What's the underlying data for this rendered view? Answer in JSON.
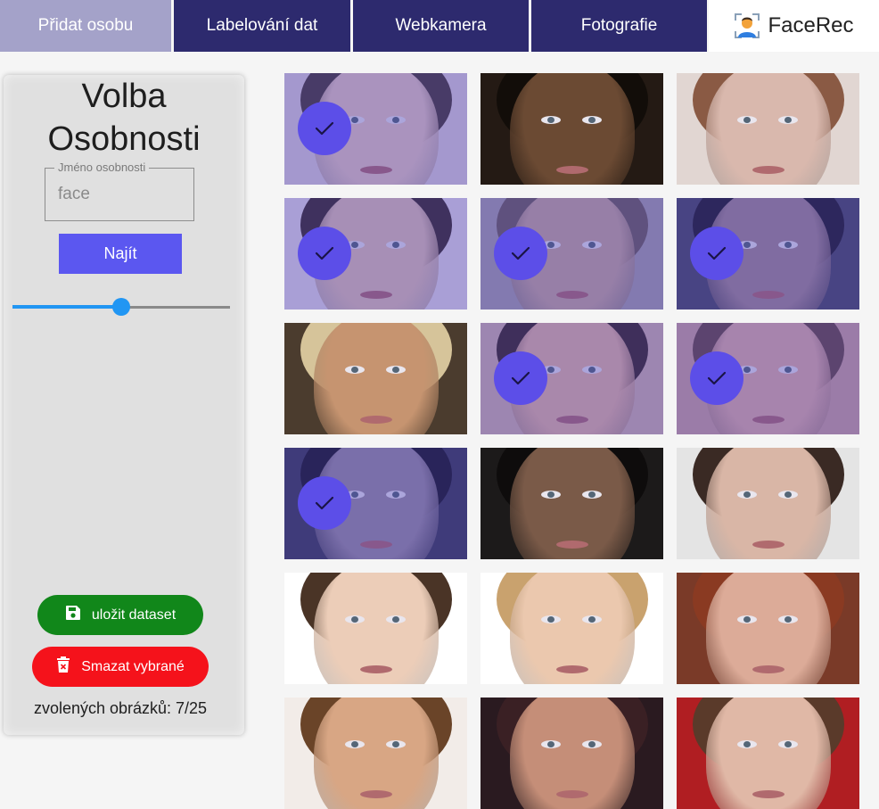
{
  "nav": {
    "tabs": [
      {
        "label": "Přidat osobu",
        "active": true
      },
      {
        "label": "Labelování dat"
      },
      {
        "label": "Webkamera"
      },
      {
        "label": "Fotografie"
      }
    ],
    "app_name": "FaceRec",
    "logo_icon": "user-face-icon"
  },
  "sidebar": {
    "title_line1": "Volba",
    "title_line2": "Osobnosti",
    "search": {
      "legend": "Jméno osobnosti",
      "value": "face"
    },
    "find_label": "Najít",
    "slider_value": 0.5,
    "save_label": "uložit dataset",
    "save_icon": "floppy-disk-icon",
    "delete_label": "Smazat vybrané",
    "delete_icon": "trash-icon",
    "count_text": "zvolených obrázků: 7/25"
  },
  "gallery": {
    "selected_icon": "checkmark-icon",
    "images": [
      {
        "selected": true,
        "bg": "#ddd0d8",
        "skin": "#e7c9bf",
        "hair": "#4a3a32"
      },
      {
        "selected": false,
        "bg": "#241a14",
        "skin": "#6b4a33",
        "hair": "#120d09"
      },
      {
        "selected": false,
        "bg": "#e1d6d2",
        "skin": "#d9b8ad",
        "hair": "#8a5a44"
      },
      {
        "selected": true,
        "bg": "#e6dce6",
        "skin": "#e2c2b2",
        "hair": "#3a2a24"
      },
      {
        "selected": true,
        "bg": "#a8a0a8",
        "skin": "#c8a89a",
        "hair": "#6e5e58"
      },
      {
        "selected": true,
        "bg": "#4a4a60",
        "skin": "#a48a90",
        "hair": "#1e1a22"
      },
      {
        "selected": false,
        "bg": "#4b3c2e",
        "skin": "#c69470",
        "hair": "#d6c49a"
      },
      {
        "selected": true,
        "bg": "#d2b4aa",
        "skin": "#e6b6a0",
        "hair": "#3a2820"
      },
      {
        "selected": true,
        "bg": "#cfa49c",
        "skin": "#e2b0a4",
        "hair": "#6a4a40"
      },
      {
        "selected": true,
        "bg": "#3a3a52",
        "skin": "#9a8e9e",
        "hair": "#18161e"
      },
      {
        "selected": false,
        "bg": "#1c1a1a",
        "skin": "#7a5a48",
        "hair": "#0e0c0c"
      },
      {
        "selected": false,
        "bg": "#e4e4e4",
        "skin": "#d9b6a6",
        "hair": "#3a2a24"
      },
      {
        "selected": false,
        "bg": "#ffffff",
        "skin": "#eccdb8",
        "hair": "#4a3426"
      },
      {
        "selected": false,
        "bg": "#ffffff",
        "skin": "#ebc8ae",
        "hair": "#c9a26e"
      },
      {
        "selected": false,
        "bg": "#7a3a28",
        "skin": "#dcab98",
        "hair": "#8a3a22"
      },
      {
        "selected": false,
        "bg": "#f2ece8",
        "skin": "#d8a684",
        "hair": "#6a4428"
      },
      {
        "selected": false,
        "bg": "#2a1a20",
        "skin": "#c58e78",
        "hair": "#3a2024"
      },
      {
        "selected": false,
        "bg": "#b01e22",
        "skin": "#e0b8a6",
        "hair": "#5a3a2a"
      }
    ]
  },
  "colors": {
    "nav_dark": "#2d2a6e",
    "nav_active": "#a4a2c9",
    "accent": "#5b57f0",
    "save": "#11871a",
    "delete": "#f5121b",
    "slider": "#2196f3",
    "check": "#5c4ee8"
  }
}
